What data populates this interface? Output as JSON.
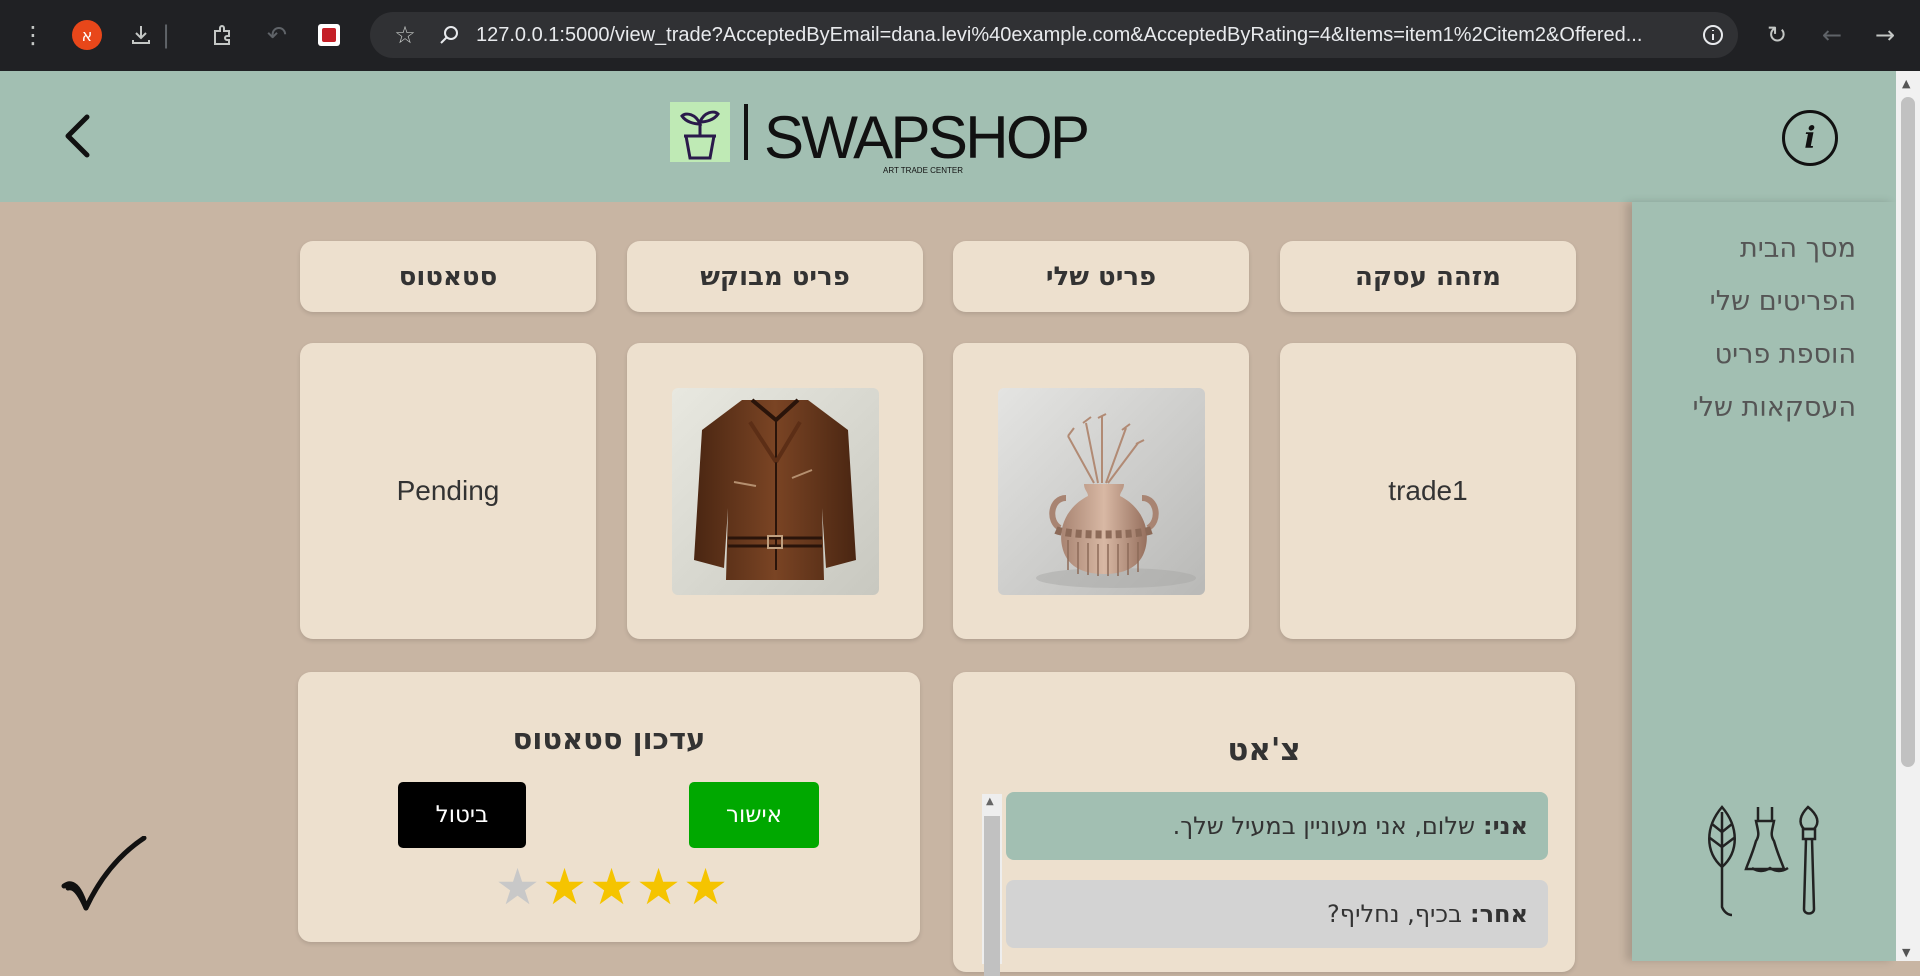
{
  "browser": {
    "profile_initial": "א",
    "url": "127.0.0.1:5000/view_trade?AcceptedByEmail=dana.levi%40example.com&AcceptedByRating=4&Items=item1%2Citem2&Offered..."
  },
  "header": {
    "logo_text": "SWAPSHOP",
    "logo_subtitle": "ART TRADE CENTER",
    "info_icon": "i"
  },
  "sidebar": {
    "items": [
      "מסך הבית",
      "הפריטים שלי",
      "הוספת פריט",
      "העסקאות שלי"
    ]
  },
  "trade": {
    "headers": [
      "מזהה עסקה",
      "פריט שלי",
      "פריט מבוקש",
      "סטאטוס"
    ],
    "trade_id": "trade1",
    "my_item": "vase-image",
    "requested_item": "leather-jacket-image",
    "status": "Pending"
  },
  "status_update": {
    "title": "עדכון סטאטוס",
    "approve_label": "אישור",
    "cancel_label": "ביטול",
    "rating": 4,
    "max_rating": 5
  },
  "chat": {
    "title": "צ'אט",
    "messages": [
      {
        "sender": "אני:",
        "text": "שלום, אני מעוניין במעיל שלך."
      },
      {
        "sender": "אחר:",
        "text": "בכיף, נחליף?"
      }
    ]
  },
  "colors": {
    "header_bg": "#a2bfb2",
    "page_bg": "#c8b5a3",
    "card_bg": "#ede0ce",
    "approve": "#00a800",
    "cancel": "#000000",
    "star_on": "#f5c400",
    "star_off": "#c8c8c8",
    "my_msg_bg": "#a2bfb2",
    "other_msg_bg": "#d3d3d3"
  }
}
